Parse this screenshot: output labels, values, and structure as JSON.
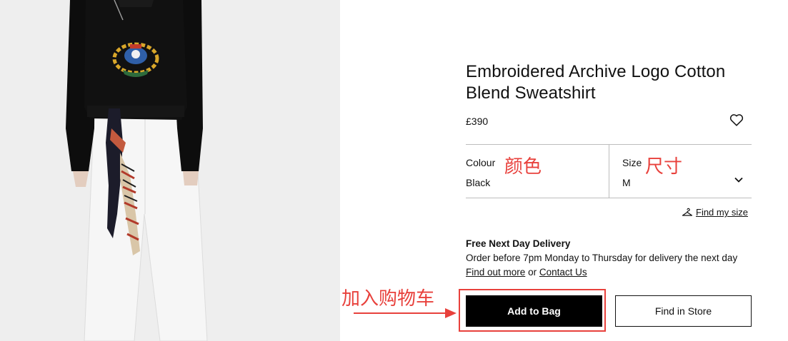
{
  "product": {
    "title": "Embroidered Archive Logo Cotton Blend Sweatshirt",
    "price": "£390",
    "image_icon": "product-photo",
    "wishlist_icon": "heart-outline-icon"
  },
  "selectors": {
    "colour": {
      "label": "Colour",
      "value": "Black"
    },
    "size": {
      "label": "Size",
      "value": "M",
      "icon": "chevron-down-icon"
    }
  },
  "find_size": {
    "label": "Find my size",
    "icon": "hanger-icon"
  },
  "delivery": {
    "title": "Free Next Day Delivery",
    "text": "Order before 7pm Monday to Thursday for delivery the next day",
    "find_out_more": "Find out more",
    "or": "or",
    "contact_us": "Contact Us"
  },
  "buttons": {
    "add_to_bag": "Add to Bag",
    "find_in_store": "Find in Store"
  },
  "annotations": {
    "colour_zh": "颜色",
    "size_zh": "尺寸",
    "add_to_cart_zh": "加入购物车",
    "color": "#e8413c"
  }
}
